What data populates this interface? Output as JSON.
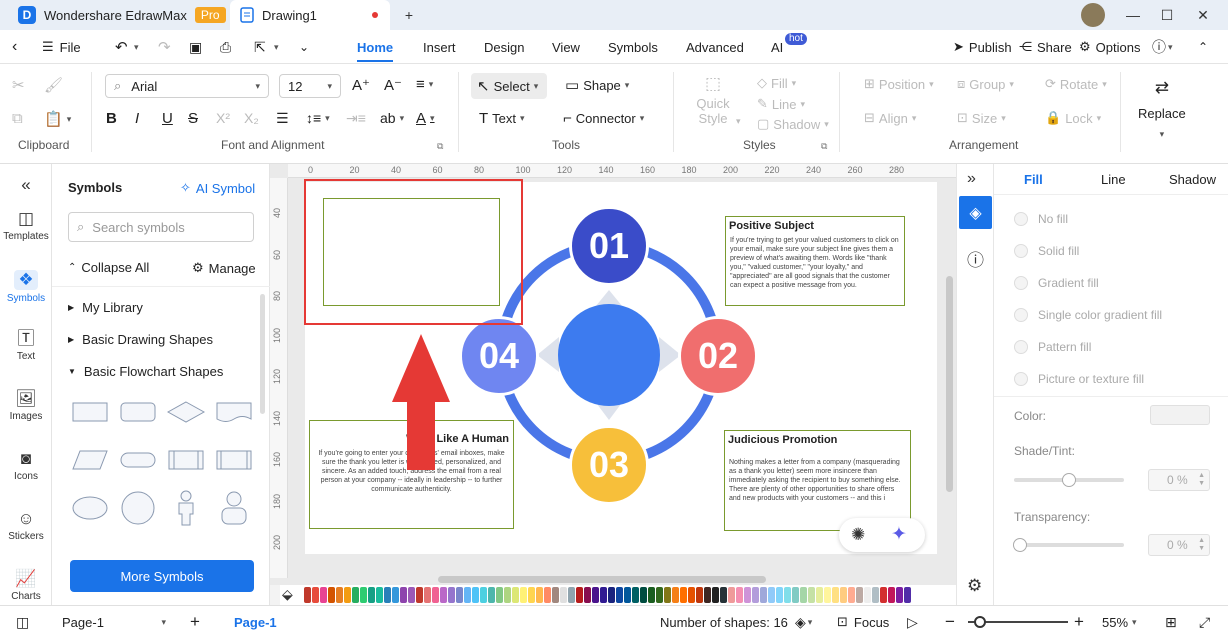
{
  "app": {
    "name": "Wondershare EdrawMax",
    "badge": "Pro",
    "document_tab": "Drawing1"
  },
  "menu": {
    "file": "File",
    "tabs": [
      "Home",
      "Insert",
      "Design",
      "View",
      "Symbols",
      "Advanced",
      "AI"
    ],
    "ai_badge": "hot",
    "right": {
      "publish": "Publish",
      "share": "Share",
      "options": "Options"
    }
  },
  "ribbon": {
    "clipboard_label": "Clipboard",
    "font": {
      "family": "Arial",
      "size": "12",
      "group_label": "Font and Alignment"
    },
    "tools": {
      "select": "Select",
      "shape": "Shape",
      "text": "Text",
      "connector": "Connector",
      "group_label": "Tools"
    },
    "styles": {
      "quick_style": "Quick Style",
      "fill": "Fill",
      "line": "Line",
      "shadow": "Shadow",
      "group_label": "Styles"
    },
    "arrangement": {
      "position": "Position",
      "group": "Group",
      "rotate": "Rotate",
      "align": "Align",
      "size": "Size",
      "lock": "Lock",
      "group_label": "Arrangement"
    },
    "replace": "Replace"
  },
  "left_rail": [
    "Templates",
    "Symbols",
    "Text",
    "Images",
    "Icons",
    "Stickers",
    "Charts"
  ],
  "symbols_panel": {
    "title": "Symbols",
    "ai_symbol": "AI Symbol",
    "search_placeholder": "Search symbols",
    "collapse_all": "Collapse All",
    "manage": "Manage",
    "libraries": [
      "My Library",
      "Basic Drawing Shapes",
      "Basic Flowchart Shapes"
    ],
    "more_symbols": "More Symbols"
  },
  "rulers": {
    "top": [
      "0",
      "20",
      "40",
      "60",
      "80",
      "100",
      "120",
      "140",
      "160",
      "180",
      "200",
      "220",
      "240",
      "260",
      "280"
    ],
    "left": [
      "40",
      "60",
      "80",
      "100",
      "120",
      "140",
      "160",
      "180",
      "200"
    ]
  },
  "diagram": {
    "nodes": [
      "01",
      "02",
      "03",
      "04"
    ],
    "box_tr": {
      "title": "Positive Subject",
      "body": "If you're trying to get your valued customers to click on your email, make sure your subject line gives them a preview of what's awaiting them. Words like \"thank you,\" \"valued customer,\" \"your loyalty,\" and \"appreciated\" are all good signals that the customer can expect a positive message from you."
    },
    "box_bl": {
      "title": "Write Like A Human",
      "body": "If you're going to enter your customers' email inboxes, make sure the thank you letter is well-crafted, personalized, and sincere. As an added touch, address the email from a real person at your company -- ideally in leadership -- to further communicate authenticity."
    },
    "box_br": {
      "title": "Judicious Promotion",
      "body": "Nothing makes a letter from a company (masquerading as a thank you letter) seem more insincere than immediately asking the recipient to buy something else. There are plenty of other opportunities to share offers and new products with your customers -- and this i"
    },
    "colors": {
      "ring": "#4a76e8",
      "center": "#3d7bef",
      "n01": "#3a4cc9",
      "n02": "#f06e6e",
      "n03": "#f7bf3a",
      "n04": "#6f86f1",
      "annotation": "#e53935"
    }
  },
  "right_panel": {
    "tabs": [
      "Fill",
      "Line",
      "Shadow"
    ],
    "options": [
      "No fill",
      "Solid fill",
      "Gradient fill",
      "Single color gradient fill",
      "Pattern fill",
      "Picture or texture fill"
    ],
    "color_label": "Color:",
    "shade_label": "Shade/Tint:",
    "shade_value": "0 %",
    "shade_level": 0.5,
    "transparency_label": "Transparency:",
    "transparency_value": "0 %",
    "transparency_level": 0
  },
  "palette": [
    "#c0392b",
    "#e74c3c",
    "#e84393",
    "#d35400",
    "#e67e22",
    "#f39c12",
    "#27ae60",
    "#2ecc71",
    "#16a085",
    "#1abc9c",
    "#2980b9",
    "#3498db",
    "#8e44ad",
    "#9b59b6",
    "#c0392b",
    "#e57373",
    "#f06292",
    "#ba68c8",
    "#9575cd",
    "#7986cb",
    "#64b5f6",
    "#4fc3f7",
    "#4dd0e1",
    "#4db6ac",
    "#81c784",
    "#aed581",
    "#dce775",
    "#fff176",
    "#ffd54f",
    "#ffb74d",
    "#ff8a65",
    "#a1887f",
    "#e0e0e0",
    "#90a4ae",
    "#b71c1c",
    "#880e4f",
    "#4a148c",
    "#311b92",
    "#1a237e",
    "#0d47a1",
    "#01579b",
    "#006064",
    "#004d40",
    "#1b5e20",
    "#33691e",
    "#827717",
    "#f57f17",
    "#ff6f00",
    "#e65100",
    "#bf360c",
    "#3e2723",
    "#212121",
    "#263238",
    "#ef9a9a",
    "#f48fb1",
    "#ce93d8",
    "#b39ddb",
    "#9fa8da",
    "#90caf9",
    "#81d4fa",
    "#80deea",
    "#80cbc4",
    "#a5d6a7",
    "#c5e1a5",
    "#e6ee9c",
    "#fff59d",
    "#ffe082",
    "#ffcc80",
    "#ffab91",
    "#bcaaa4",
    "#eeeeee",
    "#b0bec5",
    "#d32f2f",
    "#c2185b",
    "#7b1fa2",
    "#512da8"
  ],
  "status": {
    "page_select": "Page-1",
    "page_tab": "Page-1",
    "shapes": "Number of shapes: 16",
    "focus": "Focus",
    "zoom": "55%"
  }
}
